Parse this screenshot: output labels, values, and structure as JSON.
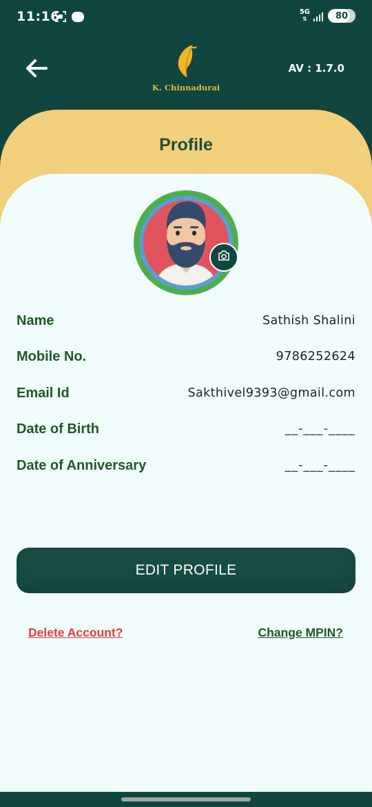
{
  "status_bar": {
    "time": "11:16",
    "network": "5G",
    "battery": "80"
  },
  "header": {
    "logo_text": "K. Chinnadurai",
    "version": "AV : 1.7.0"
  },
  "page": {
    "title": "Profile"
  },
  "profile": {
    "fields": [
      {
        "label": "Name",
        "value": "Sathish Shalini"
      },
      {
        "label": "Mobile No.",
        "value": "9786252624"
      },
      {
        "label": "Email Id",
        "value": "Sakthivel9393@gmail.com"
      },
      {
        "label": "Date of Birth",
        "value": "__-___-____"
      },
      {
        "label": "Date of Anniversary",
        "value": "__-___-____"
      }
    ]
  },
  "actions": {
    "edit_label": "EDIT PROFILE",
    "delete_label": "Delete Account?",
    "mpin_label": "Change MPIN?"
  },
  "colors": {
    "header_bg": "#114540",
    "band": "#f2cf7a",
    "card_bg": "#f0fdfc",
    "label_green": "#1e5a24",
    "button_bg": "#174c45",
    "delete_red": "#de3f3b"
  },
  "icons": {
    "back": "arrow-left-icon",
    "camera": "camera-icon",
    "logo": "feather-logo-icon"
  }
}
